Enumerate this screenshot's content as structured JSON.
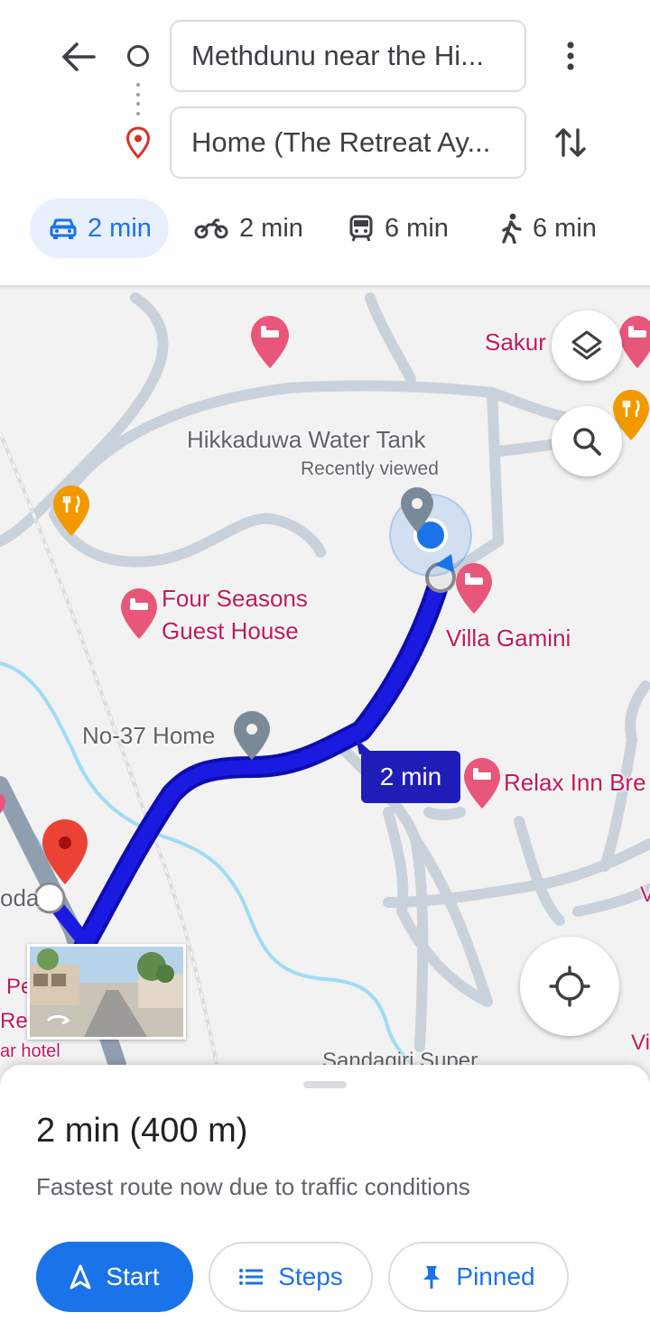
{
  "header": {
    "origin_value": "Methdunu near the Hi...",
    "destination_value": "Home (The Retreat Ay..."
  },
  "modes": [
    {
      "name": "drive",
      "icon": "car-icon",
      "time": "2 min",
      "selected": true
    },
    {
      "name": "motorbike",
      "icon": "motorbike-icon",
      "time": "2 min",
      "selected": false
    },
    {
      "name": "transit",
      "icon": "bus-icon",
      "time": "6 min",
      "selected": false
    },
    {
      "name": "walk",
      "icon": "walk-icon",
      "time": "6 min",
      "selected": false
    }
  ],
  "map": {
    "labels": {
      "sakura": "Sakur",
      "water_tank": "Hikkaduwa Water Tank",
      "recently_viewed": "Recently viewed",
      "four_seasons_1": "Four Seasons",
      "four_seasons_2": "Guest House",
      "villa_gamini": "Villa Gamini",
      "no37": "No-37 Home",
      "relax_inn": "Relax Inn Bre",
      "left_oda": "oda",
      "left_pe": "Pe",
      "left_res": "Res",
      "left_ar_hotel": "ar hotel",
      "sandagiri": "Sandagiri Super",
      "right_v1": "V",
      "right_vi": "Vi"
    },
    "route_time": "2 min",
    "colors": {
      "route": "#1a1ae0",
      "route_outline": "#0d0db0",
      "badge": "#1f1db8",
      "hotel_pin": "#e8577a",
      "food_pin": "#f29900",
      "water": "#9fdcf3",
      "road": "#c6cfd9",
      "dest_pin": "#ea4335",
      "location_dot": "#1a73e8"
    }
  },
  "sheet": {
    "summary": "2 min (400 m)",
    "subtext": "Fastest route now due to traffic conditions",
    "start_label": "Start",
    "steps_label": "Steps",
    "pinned_label": "Pinned"
  },
  "accent": "#1a73e8"
}
